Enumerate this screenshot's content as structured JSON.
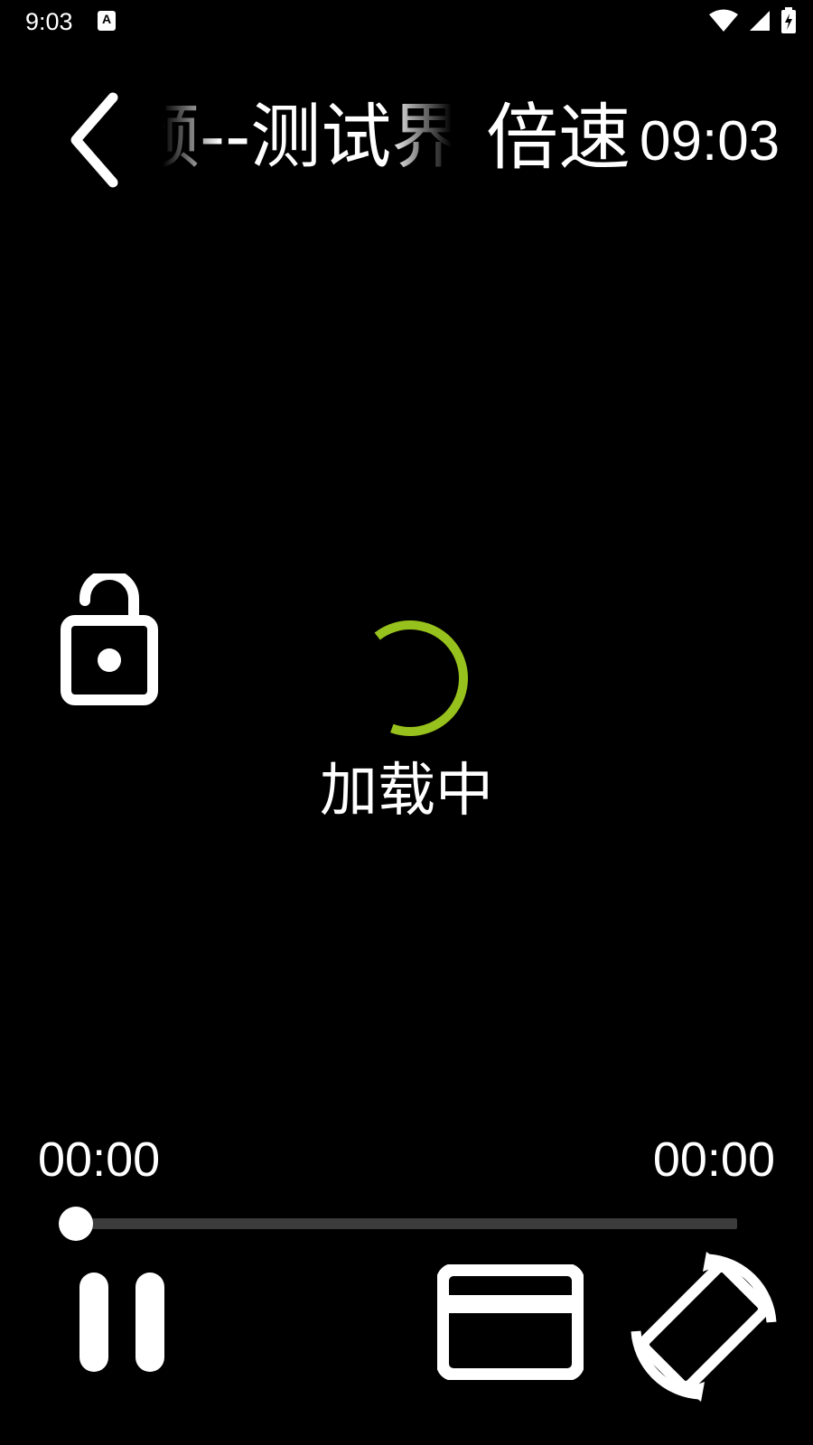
{
  "status_bar": {
    "time": "9:03",
    "app_icon_label": "A"
  },
  "top_bar": {
    "title": "视频--测试界面",
    "speed_label": "倍速",
    "clock": "09:03"
  },
  "loading": {
    "label": "加载中",
    "accent_color": "#97c11c"
  },
  "player": {
    "current_time": "00:00",
    "total_time": "00:00",
    "progress": 0
  },
  "icons": {
    "back": "chevron-left-icon",
    "lock": "unlock-icon",
    "pause": "pause-icon",
    "screen": "screen-ratio-icon",
    "rotate": "screen-rotation-icon"
  }
}
